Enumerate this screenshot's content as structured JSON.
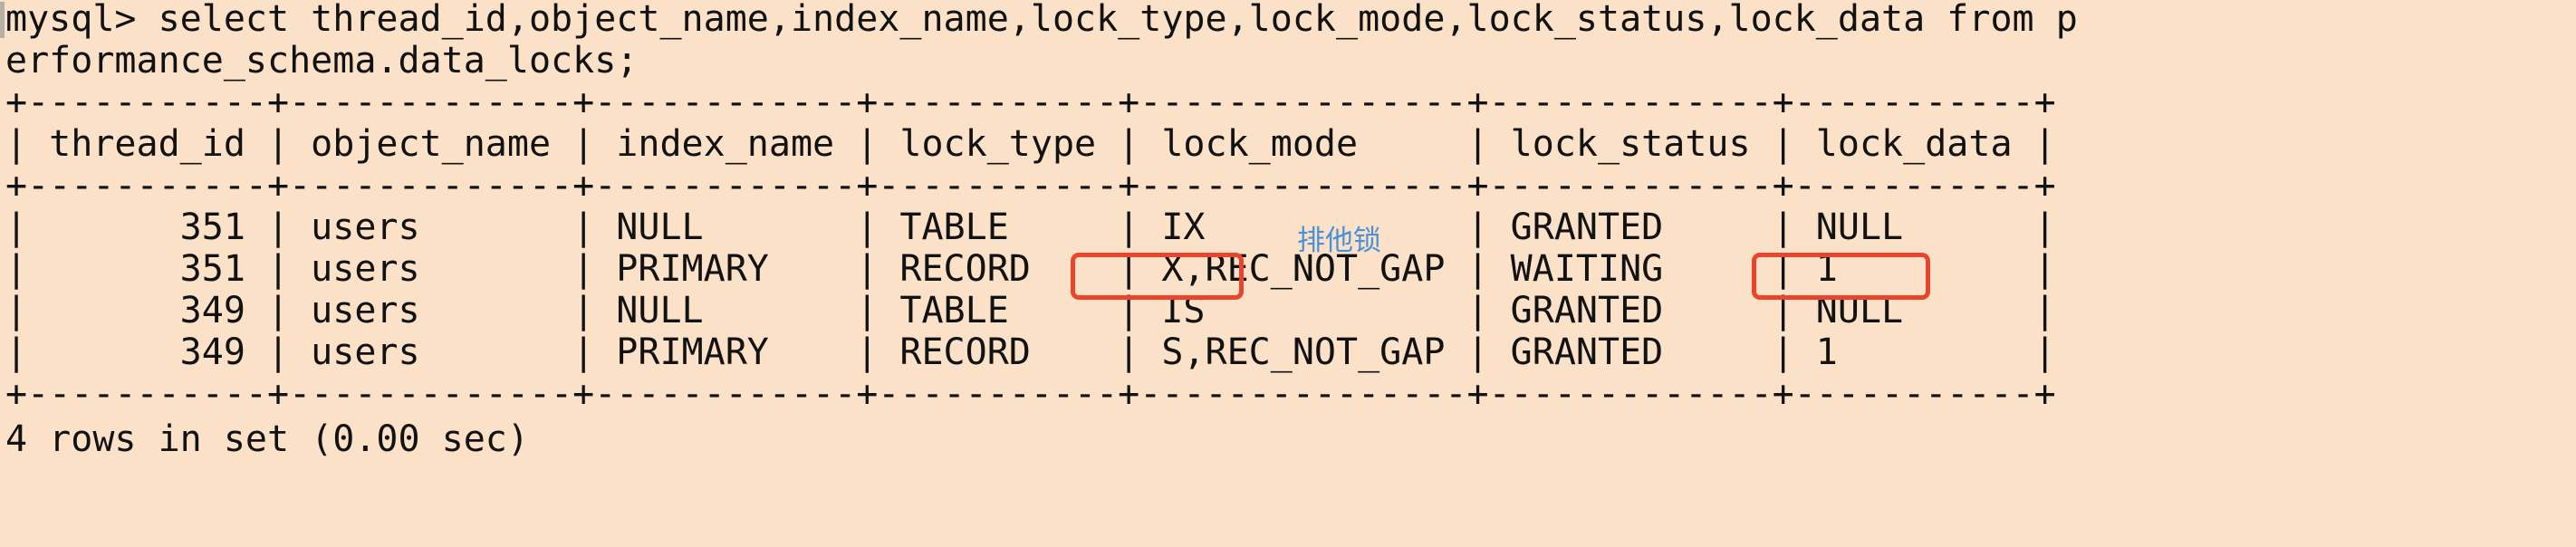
{
  "terminal": {
    "background_color": "#fae1c8",
    "text_color": "#121212",
    "annotation_color": "#4a90d9",
    "highlight_color": "#e8452c",
    "prompt": "mysql>",
    "lines": [
      "mysql> select thread_id,object_name,index_name,lock_type,lock_mode,lock_status,lock_data from p",
      "erformance_schema.data_locks;",
      "+-----------+-------------+------------+-----------+---------------+-------------+-----------+",
      "| thread_id | object_name | index_name | lock_type | lock_mode     | lock_status | lock_data |",
      "+-----------+-------------+------------+-----------+---------------+-------------+-----------+",
      "|       351 | users       | NULL       | TABLE     | IX            | GRANTED     | NULL      |",
      "|       351 | users       | PRIMARY    | RECORD    | X,REC_NOT_GAP | WAITING     | 1         |",
      "|       349 | users       | NULL       | TABLE     | IS            | GRANTED     | NULL      |",
      "|       349 | users       | PRIMARY    | RECORD    | S,REC_NOT_GAP | GRANTED     | 1         |",
      "+-----------+-------------+------------+-----------+---------------+-------------+-----------+",
      "4 rows in set (0.00 sec)"
    ],
    "query": {
      "statement": "select thread_id,object_name,index_name,lock_type,lock_mode,lock_status,lock_data from performance_schema.data_locks;",
      "table": "performance_schema.data_locks"
    },
    "result_table": {
      "columns": [
        "thread_id",
        "object_name",
        "index_name",
        "lock_type",
        "lock_mode",
        "lock_status",
        "lock_data"
      ],
      "rows": [
        [
          "351",
          "users",
          "NULL",
          "TABLE",
          "IX",
          "GRANTED",
          "NULL"
        ],
        [
          "351",
          "users",
          "PRIMARY",
          "RECORD",
          "X,REC_NOT_GAP",
          "WAITING",
          "1"
        ],
        [
          "349",
          "users",
          "NULL",
          "TABLE",
          "IS",
          "GRANTED",
          "NULL"
        ],
        [
          "349",
          "users",
          "PRIMARY",
          "RECORD",
          "S,REC_NOT_GAP",
          "GRANTED",
          "1"
        ]
      ],
      "footer": "4 rows in set (0.00 sec)"
    },
    "annotations": [
      {
        "text": "排他锁",
        "target": "IX",
        "color": "#4a90d9"
      }
    ],
    "highlights": [
      {
        "target": "RECORD",
        "color": "#e8452c"
      },
      {
        "target": "WAITING",
        "color": "#e8452c"
      }
    ]
  }
}
